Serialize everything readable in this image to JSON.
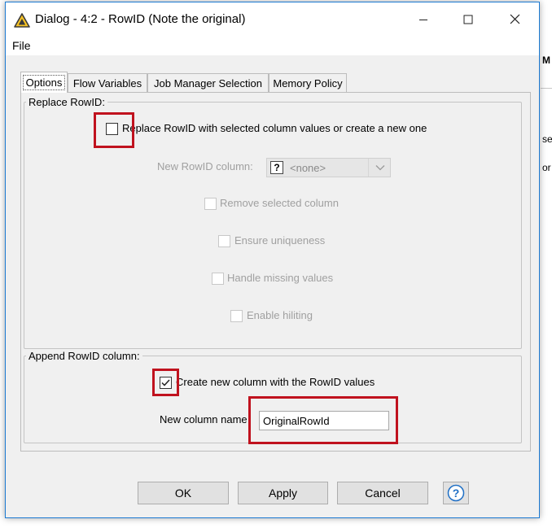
{
  "window": {
    "title": "Dialog - 4:2 - RowID (Note the original)",
    "accent_color": "#1b79d1"
  },
  "menu": {
    "file_label": "File"
  },
  "tabs": [
    {
      "label": "Options",
      "active": true
    },
    {
      "label": "Flow Variables",
      "active": false
    },
    {
      "label": "Job Manager Selection",
      "active": false
    },
    {
      "label": "Memory Policy",
      "active": false
    }
  ],
  "replace_group": {
    "title": "Replace RowID:",
    "replace_checkbox_label": "Replace RowID with selected column values or create a new one",
    "replace_checked": false,
    "new_rowid_column_label": "New RowID column:",
    "new_rowid_column_value": "<none>",
    "remove_selected_label": "Remove selected column",
    "ensure_uniqueness_label": "Ensure uniqueness",
    "handle_missing_label": "Handle missing values",
    "enable_hiliting_label": "Enable hiliting"
  },
  "append_group": {
    "title": "Append RowID column:",
    "create_column_label": "Create new column with the RowID values",
    "create_column_checked": true,
    "new_column_name_label": "New column name",
    "new_column_name_value": "OriginalRowId"
  },
  "buttons": {
    "ok": "OK",
    "apply": "Apply",
    "cancel": "Cancel"
  },
  "background_window": {
    "texts": [
      "M",
      "se",
      "or"
    ]
  },
  "highlight_color": "#c0121e"
}
